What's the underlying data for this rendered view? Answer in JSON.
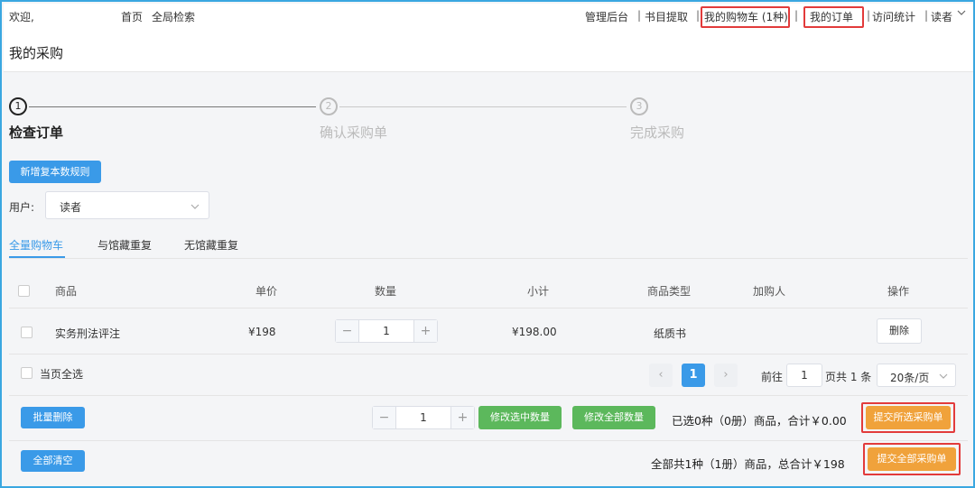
{
  "topnav": {
    "welcome": "欢迎,",
    "home": "首页",
    "global_search": "全局检索",
    "admin": "管理后台",
    "catalog": "书目提取",
    "cart": "我的购物车 (1种)",
    "orders": "我的订单",
    "stats": "访问统计",
    "user": "读者"
  },
  "page_title": "我的采购",
  "steps": [
    {
      "num": "1",
      "label": "检查订单"
    },
    {
      "num": "2",
      "label": "确认采购单"
    },
    {
      "num": "3",
      "label": "完成采购"
    }
  ],
  "add_rule_button": "新增复本数规则",
  "user_label": "用户:",
  "user_select_value": "读者",
  "tabs": [
    "全量购物车",
    "与馆藏重复",
    "无馆藏重复"
  ],
  "table": {
    "headers": {
      "product": "商品",
      "price": "单价",
      "qty": "数量",
      "subtotal": "小计",
      "type": "商品类型",
      "adder": "加购人",
      "action": "操作"
    },
    "rows": [
      {
        "product": "实务刑法评注",
        "price": "¥198",
        "qty": "1",
        "subtotal": "¥198.00",
        "type": "纸质书",
        "adder": "",
        "action": "删除"
      }
    ]
  },
  "select_page_label": "当页全选",
  "pagination": {
    "current": "1",
    "goto_label": "前往",
    "goto_value": "1",
    "page_suffix": "页共 1 条",
    "page_size": "20条/页"
  },
  "batch_delete_button": "批量删除",
  "bulk_qty": "1",
  "modify_selected_qty_button": "修改选中数量",
  "modify_all_qty_button": "修改全部数量",
  "selected_summary": "已选0种（0册）商品，合计￥0.00",
  "submit_selected_button": "提交所选采购单",
  "clear_all_button": "全部清空",
  "total_summary": "全部共1种（1册）商品，总合计￥198",
  "submit_all_button": "提交全部采购单",
  "colors": {
    "primary": "#3a9ae8",
    "green": "#5cb85c",
    "orange": "#f0a23b",
    "highlight": "#e23b3b",
    "frame": "#3aa7e0"
  }
}
